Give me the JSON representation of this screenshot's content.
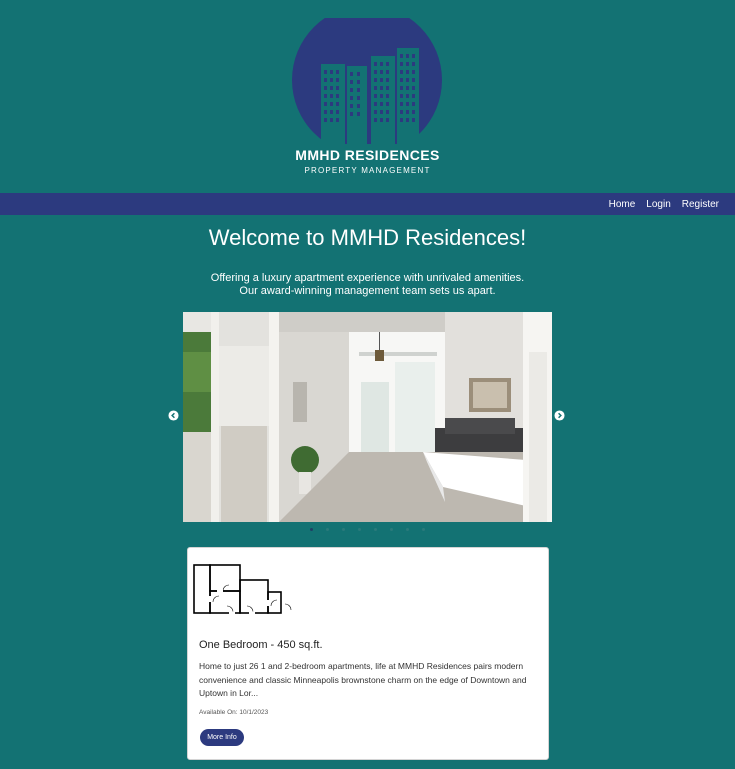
{
  "brand": {
    "name": "MMHD RESIDENCES",
    "subtitle": "PROPERTY MANAGEMENT"
  },
  "nav": {
    "items": [
      {
        "label": "Home"
      },
      {
        "label": "Login"
      },
      {
        "label": "Register"
      }
    ]
  },
  "welcome": {
    "title": "Welcome to MMHD Residences!",
    "line1": "Offering a luxury apartment experience with unrivaled amenities.",
    "line2": "Our award-winning management team sets us apart."
  },
  "carousel": {
    "prev_icon": "chevron-left-icon",
    "next_icon": "chevron-right-icon",
    "slide_count": 8,
    "active_index": 0
  },
  "listing": {
    "title": "One Bedroom - 450 sq.ft.",
    "description": "Home to just 26 1 and 2-bedroom apartments, life at MMHD Residences pairs modern convenience and classic Minneapolis brownstone charm on the edge of Downtown and Uptown in Lor...",
    "available": "Available On: 10/1/2023",
    "button_label": "More Info"
  },
  "colors": {
    "page_bg": "#137273",
    "navbar_bg": "#2c3a7f",
    "logo_circle": "#2c3a7f",
    "button_bg": "#2c3a7f",
    "card_bg": "#ffffff"
  }
}
